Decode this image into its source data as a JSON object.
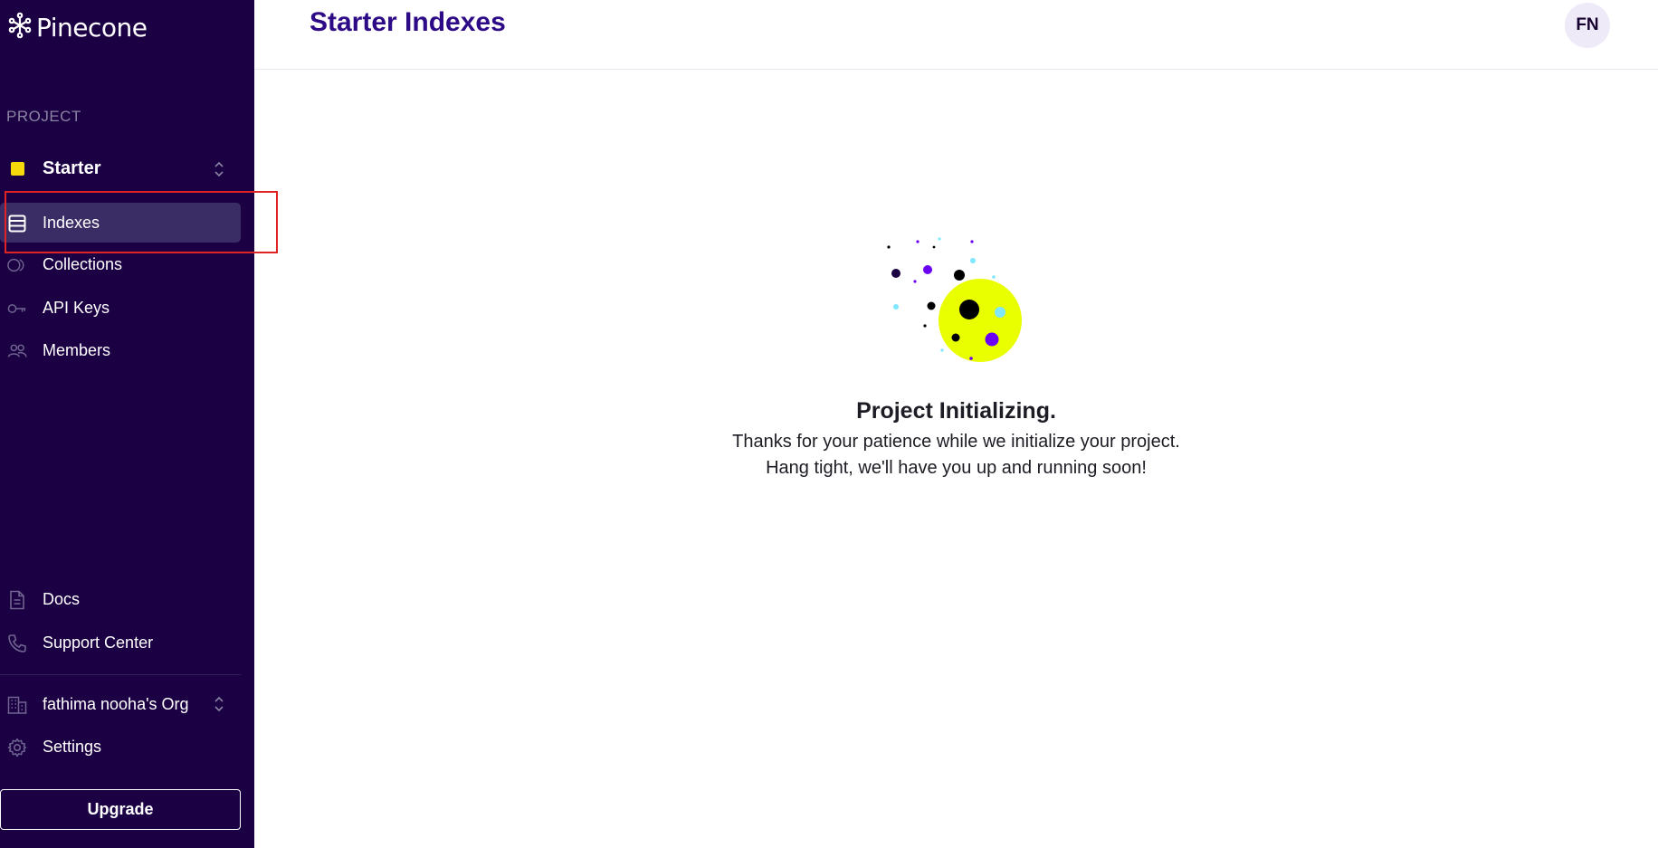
{
  "brand": {
    "name": "Pinecone"
  },
  "sidebar": {
    "section_label": "PROJECT",
    "project": {
      "name": "Starter",
      "color": "#f5d90a"
    },
    "nav": [
      {
        "label": "Indexes",
        "icon": "database-icon",
        "active": true
      },
      {
        "label": "Collections",
        "icon": "collections-icon",
        "active": false
      },
      {
        "label": "API Keys",
        "icon": "key-icon",
        "active": false
      },
      {
        "label": "Members",
        "icon": "members-icon",
        "active": false
      }
    ],
    "bottom": [
      {
        "label": "Docs",
        "icon": "document-icon"
      },
      {
        "label": "Support Center",
        "icon": "phone-icon"
      }
    ],
    "org": {
      "label": "fathima nooha's Org",
      "icon": "building-icon"
    },
    "settings": {
      "label": "Settings",
      "icon": "gear-icon"
    },
    "upgrade_label": "Upgrade"
  },
  "header": {
    "title": "Starter Indexes",
    "avatar_initials": "FN"
  },
  "main": {
    "empty_title": "Project Initializing.",
    "empty_line_1": "Thanks for your patience while we initialize your project.",
    "empty_line_2": "Hang tight, we'll have you up and running soon!"
  },
  "colors": {
    "sidebar_bg": "#1b0043",
    "title_purple": "#2d0a86",
    "accent_yellow": "#e9ff00",
    "accent_violet": "#6a00f4",
    "accent_cyan": "#7fe7ff"
  }
}
